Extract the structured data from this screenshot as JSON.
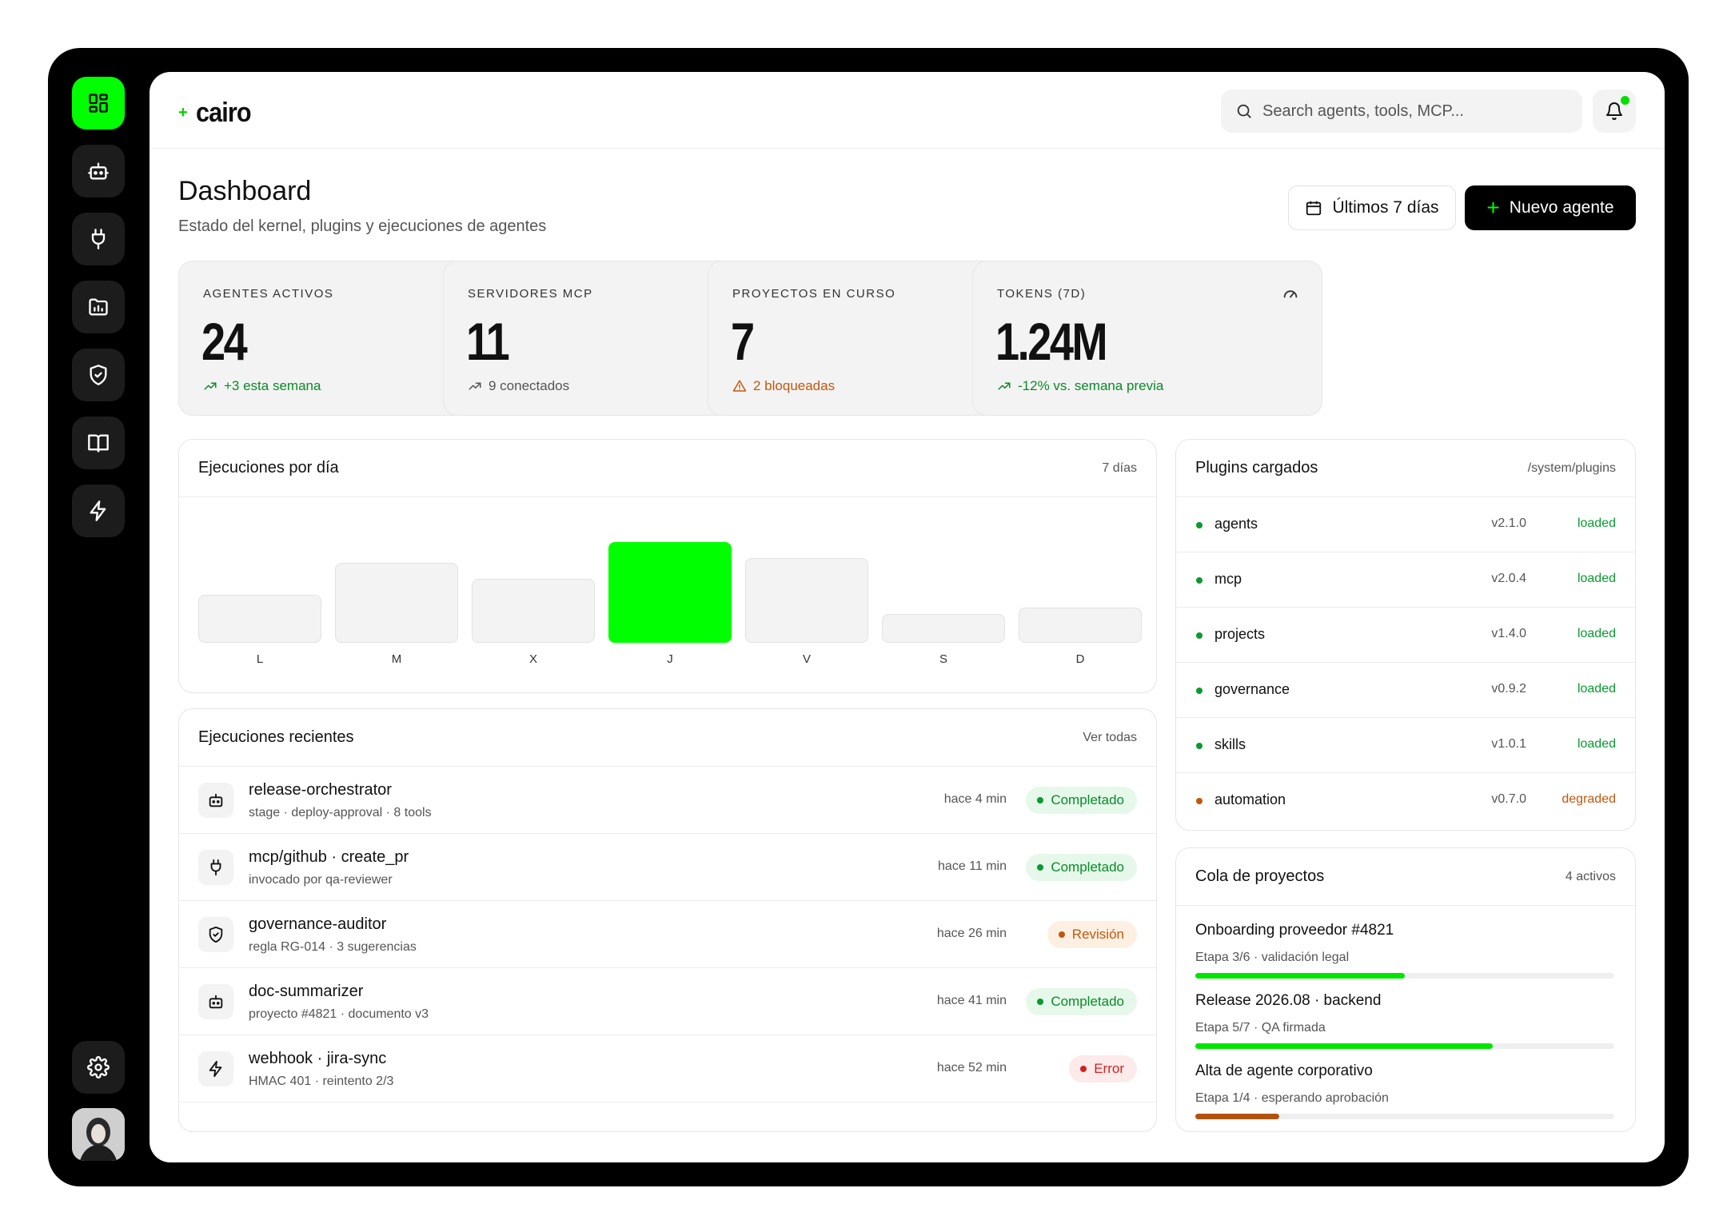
{
  "app": {
    "logo": "cairo"
  },
  "search": {
    "placeholder": "Search agents, tools, MCP..."
  },
  "header": {
    "title": "Dashboard",
    "subtitle": "Estado del kernel, plugins y ejecuciones de agentes",
    "date_range": "Últimos 7 días",
    "new_agent": "Nuevo agente"
  },
  "stats": [
    {
      "label": "Agentes activos",
      "value": "24",
      "foot": "+3 esta semana",
      "icon": "robot-icon"
    },
    {
      "label": "Servidores MCP",
      "value": "11",
      "foot": "9 conectados",
      "icon": "plug-icon"
    },
    {
      "label": "Proyectos en curso",
      "value": "7",
      "foot": "2 bloqueadas",
      "icon": "folder-chart-icon"
    },
    {
      "label": "Tokens (7d)",
      "value": "1.24M",
      "foot": "-12% vs. semana previa",
      "icon": "gauge-icon"
    }
  ],
  "executions_chart": {
    "title": "Ejecuciones por día",
    "meta": "7 días"
  },
  "chart_data": {
    "type": "bar",
    "categories": [
      "L",
      "M",
      "X",
      "J",
      "V",
      "S",
      "D"
    ],
    "values": [
      30,
      50,
      40,
      63,
      53,
      18,
      22
    ],
    "highlight_index": 3,
    "colors": {
      "default": "#f3f3f3",
      "highlight": "#00ff00"
    }
  },
  "recent": {
    "title": "Ejecuciones recientes",
    "link": "Ver todas",
    "rows": [
      {
        "name": "release-orchestrator",
        "sub": "stage · deploy-approval · 8 tools",
        "time": "hace 4 min",
        "status": "Completado",
        "kind": "ok",
        "icon": "robot-icon"
      },
      {
        "name": "mcp/github · create_pr",
        "sub": "invocado por qa-reviewer",
        "time": "hace 11 min",
        "status": "Completado",
        "kind": "ok",
        "icon": "plug-icon"
      },
      {
        "name": "governance-auditor",
        "sub": "regla RG-014 · 3 sugerencias",
        "time": "hace 26 min",
        "status": "Revisión",
        "kind": "rev",
        "icon": "shield-icon"
      },
      {
        "name": "doc-summarizer",
        "sub": "proyecto #4821 · documento v3",
        "time": "hace 41 min",
        "status": "Completado",
        "kind": "ok",
        "icon": "robot-icon"
      },
      {
        "name": "webhook · jira-sync",
        "sub": "HMAC 401 · reintento 2/3",
        "time": "hace 52 min",
        "status": "Error",
        "kind": "err",
        "icon": "bolt-icon"
      }
    ]
  },
  "plugins": {
    "title": "Plugins cargados",
    "path": "/system/plugins",
    "rows": [
      {
        "name": "agents",
        "version": "v2.1.0",
        "status": "loaded",
        "color": "#0a9a30"
      },
      {
        "name": "mcp",
        "version": "v2.0.4",
        "status": "loaded",
        "color": "#0a9a30"
      },
      {
        "name": "projects",
        "version": "v1.4.0",
        "status": "loaded",
        "color": "#0a9a30"
      },
      {
        "name": "governance",
        "version": "v0.9.2",
        "status": "loaded",
        "color": "#0a9a30"
      },
      {
        "name": "skills",
        "version": "v1.0.1",
        "status": "loaded",
        "color": "#0a9a30"
      },
      {
        "name": "automation",
        "version": "v0.7.0",
        "status": "degraded",
        "color": "#c2570c"
      }
    ]
  },
  "queue": {
    "title": "Cola de proyectos",
    "meta": "4 activos",
    "rows": [
      {
        "name": "Onboarding proveedor #4821",
        "sub": "Etapa 3/6 · validación legal",
        "progress": 0.5,
        "color": "#00e600"
      },
      {
        "name": "Release 2026.08 · backend",
        "sub": "Etapa 5/7 · QA firmada",
        "progress": 0.71,
        "color": "#00e600"
      },
      {
        "name": "Alta de agente corporativo",
        "sub": "Etapa 1/4 · esperando aprobación",
        "progress": 0.2,
        "color": "#b3520e"
      }
    ]
  }
}
